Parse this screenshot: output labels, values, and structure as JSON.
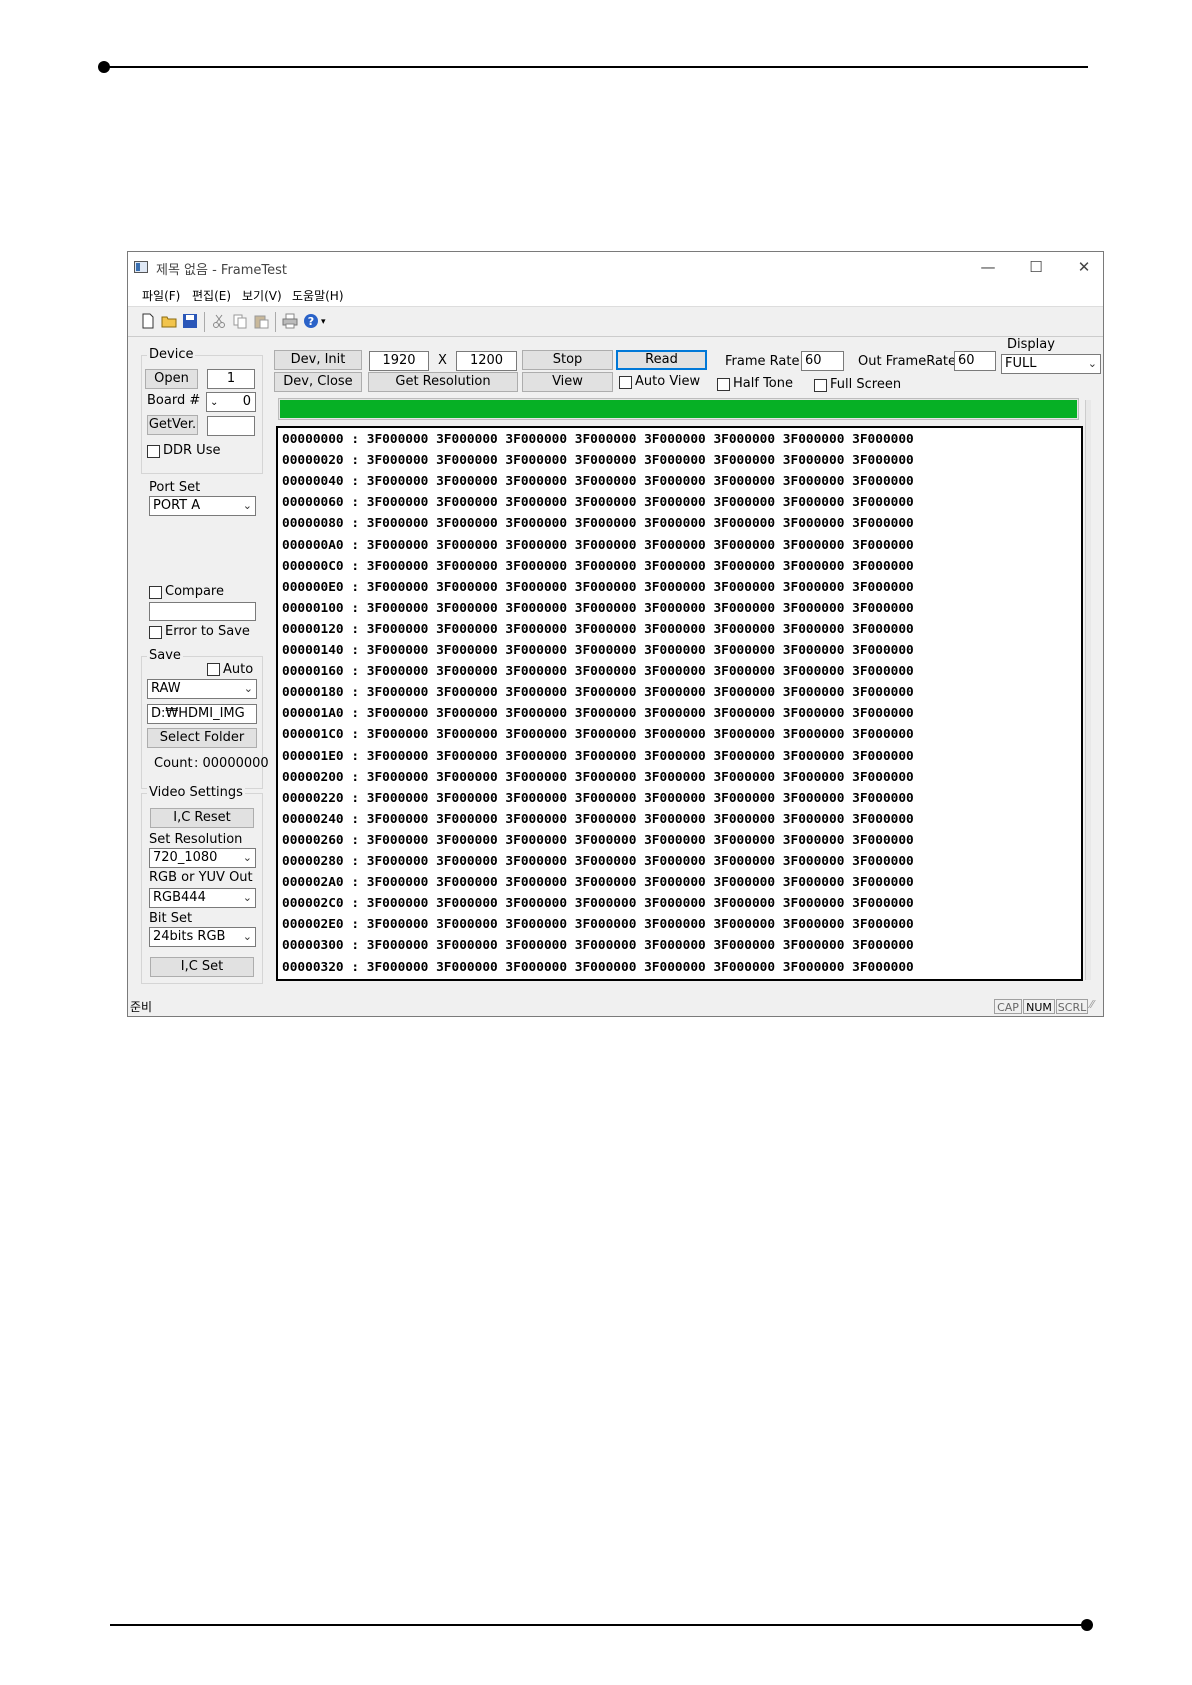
{
  "window": {
    "title": "제목 없음 - FrameTest",
    "buttons": [
      "—",
      "☐",
      "✕"
    ]
  },
  "menu": [
    "파일(F)",
    "편집(E)",
    "보기(V)",
    "도움말(H)"
  ],
  "toolbar": [
    "new-icon",
    "open-icon",
    "save-icon",
    "cut-icon",
    "copy-icon",
    "paste-icon",
    "print-icon",
    "help-icon"
  ],
  "device": {
    "group_label": "Device",
    "open_button": "Open",
    "open_value": "1",
    "board_label": "Board #",
    "board_value": "0",
    "getver_button": "GetVer.",
    "getver_value": "",
    "ddr_label": "DDR Use"
  },
  "port": {
    "label": "Port Set",
    "value": "PORT A"
  },
  "compare": {
    "label": "Compare",
    "value": "",
    "error_label": "Error to Save"
  },
  "save": {
    "label": "Save",
    "auto_label": "Auto",
    "format": "RAW",
    "folder": "D:₩HDMI_IMG",
    "select_folder": "Select Folder",
    "count_label": "Count",
    "count_value": ": 00000000"
  },
  "video": {
    "group_label": "Video Settings",
    "reset_button": "I,C Reset",
    "resolution_label": "Set Resolution",
    "resolution_value": "720_1080",
    "rgb_label": "RGB or YUV Out",
    "rgb_value": "RGB444",
    "bit_label": "Bit Set",
    "bit_value": "24bits RGB",
    "set_button": "I,C Set"
  },
  "controls": {
    "dev_init": "Dev,    Init",
    "dev_close": "Dev, Close",
    "width": "1920",
    "x": "X",
    "height": "1200",
    "get_resolution": "Get Resolution",
    "stop": "Stop",
    "view": "View",
    "read": "Read",
    "auto_view": "Auto View",
    "frame_rate_label": "Frame Rate",
    "frame_rate": "60",
    "half_tone": "Half Tone",
    "out_frame_rate_label": "Out FrameRate",
    "out_frame_rate": "60",
    "full_screen": "Full Screen",
    "display_label": "Display",
    "display_value": "FULL"
  },
  "progress": 1.0,
  "progress_color": "#06b025",
  "dump": {
    "addresses": [
      "00000000",
      "00000020",
      "00000040",
      "00000060",
      "00000080",
      "000000A0",
      "000000C0",
      "000000E0",
      "00000100",
      "00000120",
      "00000140",
      "00000160",
      "00000180",
      "000001A0",
      "000001C0",
      "000001E0",
      "00000200",
      "00000220",
      "00000240",
      "00000260",
      "00000280",
      "000002A0",
      "000002C0",
      "000002E0",
      "00000300",
      "00000320"
    ],
    "word": "3F000000",
    "words_per_row": 8
  },
  "status": {
    "text": "준비",
    "panes": [
      "CAP",
      "NUM",
      "SCRL"
    ]
  }
}
